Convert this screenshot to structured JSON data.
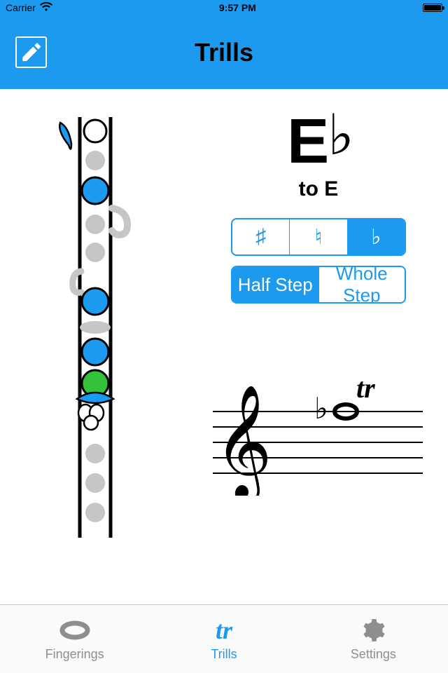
{
  "status": {
    "carrier": "Carrier",
    "time": "9:57 PM"
  },
  "nav": {
    "title": "Trills"
  },
  "note": {
    "letter": "E",
    "accidental": "♭",
    "to": "to E"
  },
  "accidental_segments": {
    "sharp": "♯",
    "natural": "♮",
    "flat": "♭",
    "active_index": 2
  },
  "step_segments": {
    "half": "Half Step",
    "whole": "Whole Step",
    "active_index": 0
  },
  "tabs": {
    "fingerings": "Fingerings",
    "trills": "Trills",
    "settings": "Settings",
    "active_index": 1
  },
  "colors": {
    "primary": "#1b9af0",
    "key_closed": "#1b9af0",
    "key_open": "#ffffff",
    "key_disabled": "#c6c6c6",
    "key_trill": "#34c23a"
  }
}
